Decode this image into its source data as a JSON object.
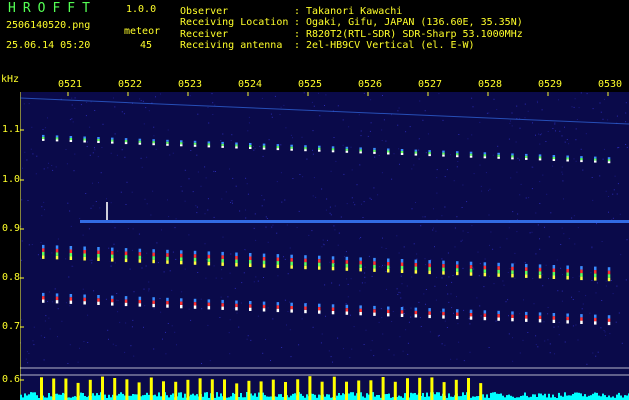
{
  "app": {
    "title": "HROFFT",
    "version": "1.0.0",
    "filename": "2506140520.png",
    "meteor_label": "meteor",
    "meteor_count": "45",
    "timestamp": "25.06.14 05:20"
  },
  "info": [
    {
      "label": "Observer",
      "sep": ":",
      "value": "Takanori Kawachi"
    },
    {
      "label": "Receiving Location",
      "sep": ":",
      "value": "Ogaki, Gifu, JAPAN (136.60E, 35.35N)"
    },
    {
      "label": "Receiver",
      "sep": ":",
      "value": "R820T2(RTL-SDR) SDR-Sharp 53.1000MHz"
    },
    {
      "label": "Receiving antenna",
      "sep": ":",
      "value": "2el-HB9CV Vertical (el. E-W)"
    }
  ],
  "chart_data": {
    "type": "heatmap",
    "ylabel": "kHz",
    "yticks": [
      "1.1",
      "1.0",
      "0.9",
      "0.8",
      "0.7",
      "0.6"
    ],
    "xticks": [
      "0521",
      "0522",
      "0523",
      "0524",
      "0525",
      "0526",
      "0527",
      "0528",
      "0529",
      "0530"
    ],
    "colors": {
      "background": "#0a0a4a",
      "ticks": "#ffff2a",
      "grid": "#ffffff",
      "carrier": "#3a7cff",
      "histogram_bar": "#ffff00",
      "histogram_noise": "#00ffff"
    }
  }
}
